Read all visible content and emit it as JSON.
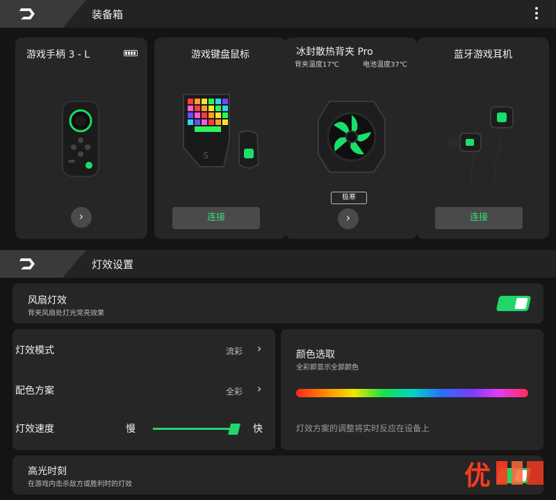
{
  "header": {
    "title": "装备箱",
    "more_icon": "more-vertical-icon"
  },
  "devices": [
    {
      "name": "游戏手柄 3 - L",
      "battery_icon": "battery-icon",
      "action_icon": "chevron-right-icon",
      "action": "›"
    },
    {
      "name": "游戏键盘鼠标",
      "action": "连接"
    },
    {
      "name": "冰封散热背夹 Pro",
      "back_temp": "背夹温度17℃",
      "battery_temp": "电池温度37℃",
      "mode_tag": "极寒",
      "action": "›"
    },
    {
      "name": "蓝牙游戏耳机",
      "action": "连接"
    }
  ],
  "lighting_header": {
    "title": "灯效设置"
  },
  "fan_light": {
    "title": "风扇灯效",
    "desc": "背夹风扇处灯光常亮效果",
    "enabled": true
  },
  "light_mode": {
    "label": "灯效模式",
    "value": "流彩"
  },
  "color_scheme": {
    "label": "配色方案",
    "value": "全彩"
  },
  "light_speed": {
    "label": "灯效速度",
    "slow": "慢",
    "fast": "快",
    "level": 0.95
  },
  "color_pick": {
    "title": "颜色选取",
    "desc": "全彩即显示全部颜色",
    "note": "灯效方案的调整将实时反应在设备上"
  },
  "highlight": {
    "title": "高光时刻",
    "desc": "在游戏内击杀敌方或胜利时的灯效"
  },
  "watermark": {
    "text": "优"
  },
  "colors": {
    "accent": "#23d56c",
    "card": "#262626",
    "background": "#141414"
  }
}
